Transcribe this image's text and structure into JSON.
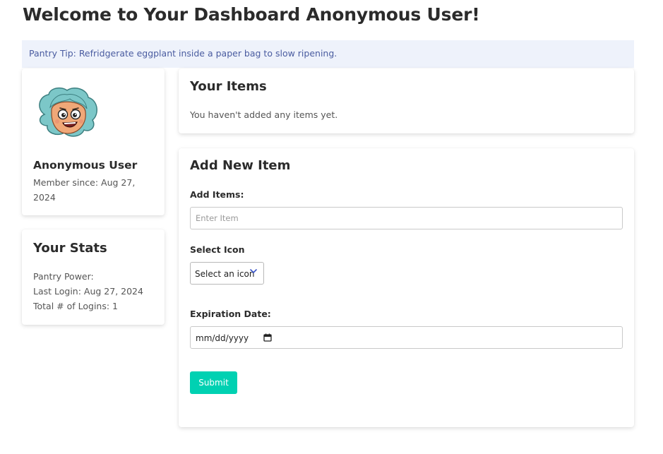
{
  "header": {
    "title": "Welcome to Your Dashboard Anonymous User!"
  },
  "tip": {
    "text": "Pantry Tip: Refridgerate eggplant inside a paper bag to slow ripening."
  },
  "profile": {
    "name": "Anonymous User",
    "member_since": "Member since: Aug 27, 2024"
  },
  "stats": {
    "title": "Your Stats",
    "pantry_power": "Pantry Power:",
    "last_login": "Last Login: Aug 27, 2024",
    "total_logins": "Total # of Logins: 1"
  },
  "items": {
    "title": "Your Items",
    "empty_message": "You haven't added any items yet."
  },
  "add_item": {
    "title": "Add New Item",
    "items_label": "Add Items:",
    "items_placeholder": "Enter Item",
    "icon_label": "Select Icon",
    "icon_selected": "Select an icon",
    "expiration_label": "Expiration Date:",
    "date_placeholder": "mm/dd/yyyy",
    "submit_label": "Submit"
  },
  "colors": {
    "accent": "#00d1b2",
    "tip_bg": "#eef2fb",
    "tip_text": "#4a5ca0",
    "avatar_hair": "#7cc7c8"
  },
  "icons": [
    "avatar-cartoon",
    "chevron-down-icon",
    "calendar-icon"
  ]
}
